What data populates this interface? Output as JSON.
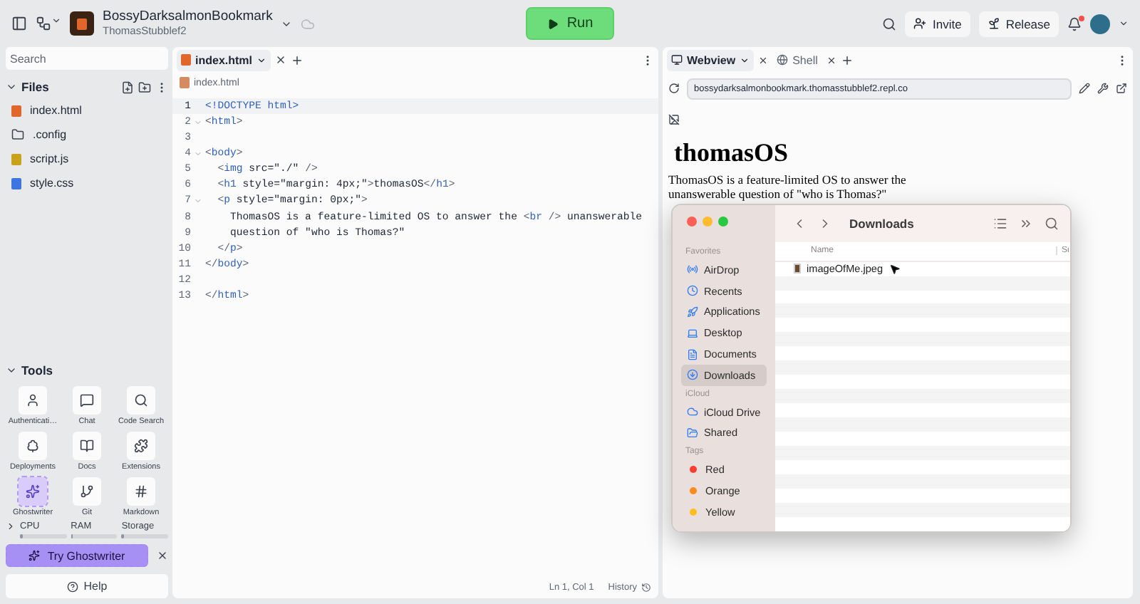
{
  "topbar": {
    "project": "BossyDarksalmonBookmark",
    "owner": "ThomasStubblef2",
    "run": "Run",
    "invite": "Invite",
    "release": "Release",
    "notification": true
  },
  "sidebar": {
    "search": {
      "placeholder": "Search"
    },
    "files_title": "Files",
    "files": [
      {
        "name": "index.html",
        "kind": "html"
      },
      {
        "name": ".config",
        "kind": "folder"
      },
      {
        "name": "script.js",
        "kind": "js"
      },
      {
        "name": "style.css",
        "kind": "css"
      }
    ],
    "tools_title": "Tools",
    "tools": [
      {
        "label": "Authenticati…",
        "selected": false
      },
      {
        "label": "Chat",
        "selected": false
      },
      {
        "label": "Code Search",
        "selected": false
      },
      {
        "label": "Deployments",
        "selected": false
      },
      {
        "label": "Docs",
        "selected": false
      },
      {
        "label": "Extensions",
        "selected": false
      },
      {
        "label": "Ghostwriter",
        "selected": true
      },
      {
        "label": "Git",
        "selected": false
      },
      {
        "label": "Markdown",
        "selected": false
      }
    ],
    "meters": [
      {
        "label": "CPU",
        "level": 0.05
      },
      {
        "label": "RAM",
        "level": 0.05
      },
      {
        "label": "Storage",
        "level": 0.05
      }
    ],
    "ghostwriter": "Try Ghostwriter",
    "help": "Help"
  },
  "editor": {
    "tab": "index.html",
    "breadcrumb": "index.html",
    "status": "Ln 1, Col 1",
    "history": "History",
    "lines": [
      {
        "number": "1",
        "current": true,
        "foldable": false,
        "segments": [
          {
            "kind": "tag",
            "text": "<!DOCTYPE html>"
          }
        ]
      },
      {
        "number": "2",
        "current": false,
        "foldable": true,
        "segments": [
          {
            "kind": "punct",
            "text": "<"
          },
          {
            "kind": "tag",
            "text": "html"
          },
          {
            "kind": "punct",
            "text": ">"
          }
        ]
      },
      {
        "number": "3",
        "current": false,
        "foldable": false
      },
      {
        "number": "4",
        "current": false,
        "foldable": true,
        "segments": [
          {
            "kind": "punct",
            "text": "<"
          },
          {
            "kind": "tag",
            "text": "body"
          },
          {
            "kind": "punct",
            "text": ">"
          }
        ]
      },
      {
        "number": "5",
        "current": false,
        "foldable": false,
        "segments": [
          {
            "kind": "punct",
            "text": "  <"
          },
          {
            "kind": "tag",
            "text": "img"
          },
          {
            "kind": "plain",
            "text": " src=\"./\" "
          },
          {
            "kind": "punct",
            "text": "/>"
          }
        ]
      },
      {
        "number": "6",
        "current": false,
        "foldable": false,
        "segments": [
          {
            "kind": "punct",
            "text": "  <"
          },
          {
            "kind": "tag",
            "text": "h1"
          },
          {
            "kind": "plain",
            "text": " style=\"margin: 4px;\""
          },
          {
            "kind": "punct",
            "text": ">"
          },
          {
            "kind": "plain",
            "text": "thomasOS"
          },
          {
            "kind": "punct",
            "text": "</"
          },
          {
            "kind": "tag",
            "text": "h1"
          },
          {
            "kind": "punct",
            "text": ">"
          }
        ]
      },
      {
        "number": "7",
        "current": false,
        "foldable": true,
        "segments": [
          {
            "kind": "punct",
            "text": "  <"
          },
          {
            "kind": "tag",
            "text": "p"
          },
          {
            "kind": "plain",
            "text": " style=\"margin: 0px;\""
          },
          {
            "kind": "punct",
            "text": ">"
          }
        ]
      },
      {
        "number": "8",
        "current": false,
        "foldable": false,
        "segments": [
          {
            "kind": "plain",
            "text": "    ThomasOS is a feature-limited OS to answer the "
          },
          {
            "kind": "punct",
            "text": "<"
          },
          {
            "kind": "tag",
            "text": "br"
          },
          {
            "kind": "punct",
            "text": " />"
          },
          {
            "kind": "plain",
            "text": " unanswerable"
          }
        ]
      },
      {
        "number": "9",
        "current": false,
        "foldable": false,
        "segments": [
          {
            "kind": "plain",
            "text": "    question of \"who is Thomas?\""
          }
        ]
      },
      {
        "number": "10",
        "current": false,
        "foldable": false,
        "segments": [
          {
            "kind": "punct",
            "text": "  </"
          },
          {
            "kind": "tag",
            "text": "p"
          },
          {
            "kind": "punct",
            "text": ">"
          }
        ]
      },
      {
        "number": "11",
        "current": false,
        "foldable": false,
        "segments": [
          {
            "kind": "punct",
            "text": "</"
          },
          {
            "kind": "tag",
            "text": "body"
          },
          {
            "kind": "punct",
            "text": ">"
          }
        ]
      },
      {
        "number": "12",
        "current": false,
        "foldable": false
      },
      {
        "number": "13",
        "current": false,
        "foldable": false,
        "segments": [
          {
            "kind": "punct",
            "text": "</"
          },
          {
            "kind": "tag",
            "text": "html"
          },
          {
            "kind": "punct",
            "text": ">"
          }
        ]
      }
    ]
  },
  "preview": {
    "tabs": [
      {
        "label": "Webview",
        "selected": true
      },
      {
        "label": "Shell",
        "selected": false
      }
    ],
    "url": "bossydarksalmonbookmark.thomasstubblef2.repl.co",
    "heading": "thomasOS",
    "paragraph": [
      "ThomasOS is a feature-limited OS to answer the",
      "unanswerable question of \"who is Thomas?\""
    ]
  },
  "finder": {
    "title": "Downloads",
    "column_1": "Name",
    "column_2": "Si",
    "sections": [
      {
        "title": "Favorites",
        "items": [
          {
            "label": "AirDrop",
            "kind": "place",
            "selected": false
          },
          {
            "label": "Recents",
            "kind": "place",
            "selected": false
          },
          {
            "label": "Applications",
            "kind": "place",
            "selected": false
          },
          {
            "label": "Desktop",
            "kind": "place",
            "selected": false
          },
          {
            "label": "Documents",
            "kind": "place",
            "selected": false
          },
          {
            "label": "Downloads",
            "kind": "place",
            "selected": true
          }
        ]
      },
      {
        "title": "iCloud",
        "items": [
          {
            "label": "iCloud Drive",
            "kind": "place",
            "selected": false
          },
          {
            "label": "Shared",
            "kind": "place",
            "selected": false
          }
        ]
      },
      {
        "title": "Tags",
        "items": [
          {
            "label": "Red",
            "kind": "tag",
            "color": "#ff3b30",
            "selected": false
          },
          {
            "label": "Orange",
            "kind": "tag",
            "color": "#ff8a1c",
            "selected": false
          },
          {
            "label": "Yellow",
            "kind": "tag",
            "color": "#ffbf1a",
            "selected": false
          }
        ]
      }
    ],
    "files": [
      {
        "name": "imageOfMe.jpeg"
      }
    ]
  }
}
